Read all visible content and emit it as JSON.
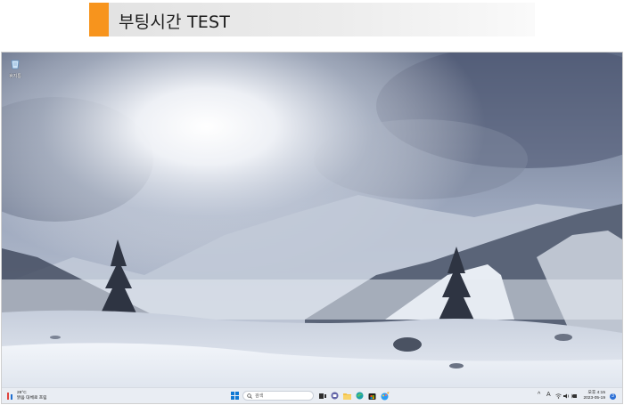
{
  "banner": {
    "title": "부팅시간 TEST"
  },
  "desktop": {
    "icons": [
      {
        "label": "휴지통",
        "icon": "recycle-bin-icon"
      }
    ]
  },
  "taskbar": {
    "weather": {
      "temp": "28°C",
      "desc": "맑음 대체로 흐림",
      "icon": "weather-cloud-sun-icon"
    },
    "search": {
      "placeholder": "검색",
      "icon": "search-icon"
    },
    "start_icon": "windows-start-icon",
    "pinned": [
      {
        "name": "task-view-icon"
      },
      {
        "name": "chat-icon"
      },
      {
        "name": "file-explorer-icon"
      },
      {
        "name": "edge-browser-icon"
      },
      {
        "name": "store-icon"
      },
      {
        "name": "paint-icon"
      }
    ],
    "tray": {
      "chevron": "^",
      "ime": "A",
      "icons": [
        "wifi-icon",
        "volume-icon",
        "battery-icon"
      ]
    },
    "clock": {
      "time": "오후 4:15",
      "date": "2023-05-19"
    },
    "notification_count": "3"
  },
  "colors": {
    "accent_orange": "#f7941d",
    "taskbar_bg": "#e9edf3",
    "windows_blue": "#0f78d4"
  }
}
